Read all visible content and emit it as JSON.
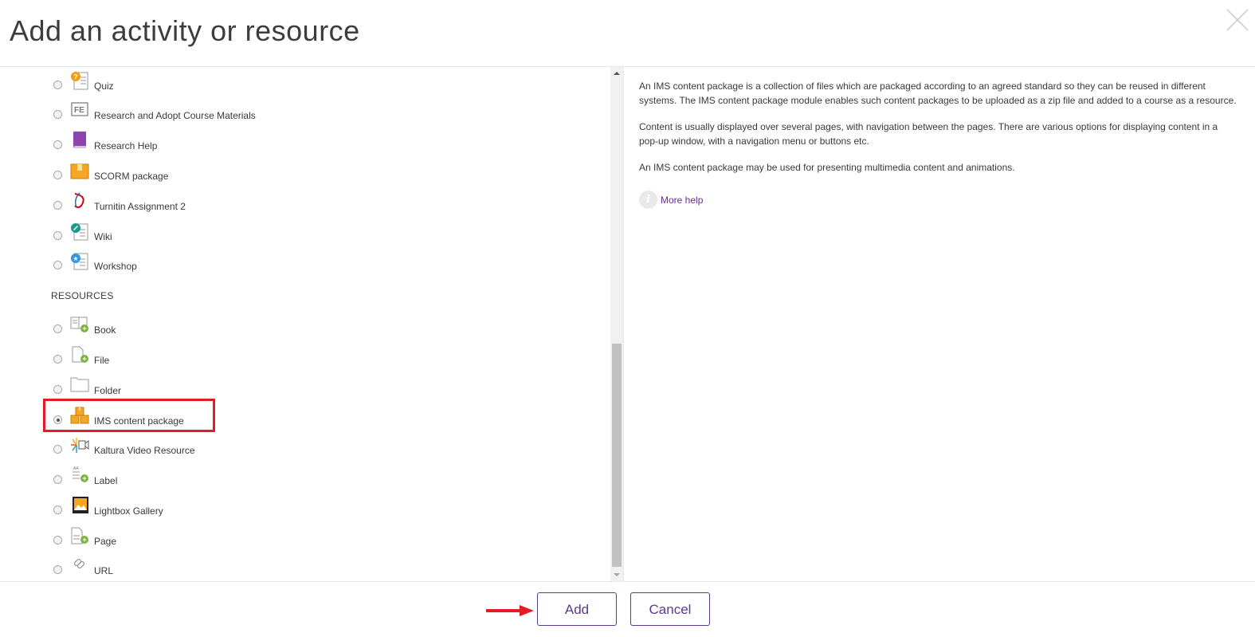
{
  "dialog": {
    "title": "Add an activity or resource"
  },
  "options": [
    {
      "label": "Quiz",
      "icon": "quiz-icon"
    },
    {
      "label": "Research and Adopt Course Materials",
      "icon": "research-materials-icon"
    },
    {
      "label": "Research Help",
      "icon": "book-purple-icon"
    },
    {
      "label": "SCORM package",
      "icon": "scorm-package-icon"
    },
    {
      "label": "Turnitin Assignment 2",
      "icon": "turnitin-icon"
    },
    {
      "label": "Wiki",
      "icon": "wiki-icon"
    },
    {
      "label": "Workshop",
      "icon": "workshop-icon"
    }
  ],
  "resources_header": "RESOURCES",
  "resources": [
    {
      "label": "Book",
      "icon": "book-icon"
    },
    {
      "label": "File",
      "icon": "file-icon"
    },
    {
      "label": "Folder",
      "icon": "folder-icon"
    },
    {
      "label": "IMS content package",
      "icon": "ims-package-icon",
      "selected": true
    },
    {
      "label": "Kaltura Video Resource",
      "icon": "kaltura-video-icon"
    },
    {
      "label": "Label",
      "icon": "label-icon"
    },
    {
      "label": "Lightbox Gallery",
      "icon": "lightbox-gallery-icon"
    },
    {
      "label": "Page",
      "icon": "page-icon"
    },
    {
      "label": "URL",
      "icon": "url-link-icon"
    }
  ],
  "description": {
    "p1": "An IMS content package is a collection of files which are packaged according to an agreed standard so they can be reused in different systems. The IMS content package module enables such content packages to be uploaded as a zip file and added to a course as a resource.",
    "p2": "Content is usually displayed over several pages, with navigation between the pages. There are various options for displaying content in a pop-up window, with a navigation menu or buttons etc.",
    "p3": "An IMS content package may be used for presenting multimedia content and animations.",
    "more_help": "More help"
  },
  "footer": {
    "add_label": "Add",
    "cancel_label": "Cancel"
  },
  "colors": {
    "accent": "#5b3a8b",
    "highlight": "#e21b24",
    "link": "#6a2c91"
  }
}
